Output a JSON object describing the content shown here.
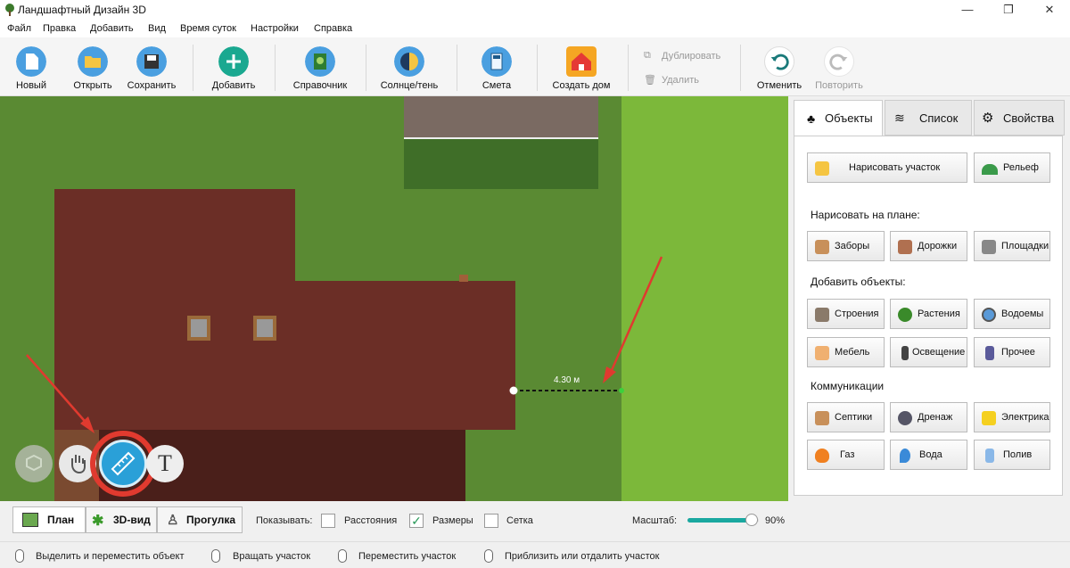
{
  "window": {
    "title": "Ландшафтный Дизайн 3D",
    "minimize": "—",
    "maximize": "❐",
    "close": "✕"
  },
  "menu": [
    "Файл",
    "Правка",
    "Добавить",
    "Вид",
    "Время суток",
    "Настройки",
    "Справка"
  ],
  "toolbar": {
    "new": "Новый",
    "open": "Открыть",
    "save": "Сохранить",
    "add": "Добавить",
    "reference": "Справочник",
    "sun": "Солнце/тень",
    "estimate": "Смета",
    "create_house": "Создать дом",
    "duplicate": "Дублировать",
    "delete": "Удалить",
    "undo": "Отменить",
    "redo": "Повторить"
  },
  "canvas": {
    "measure_label": "4.30 м",
    "text_tool": "T"
  },
  "panel": {
    "tabs": [
      "Объекты",
      "Список",
      "Свойства"
    ],
    "draw_plot": "Нарисовать участок",
    "relief": "Рельеф",
    "draw_on_plan": "Нарисовать на плане:",
    "draw_items": [
      "Заборы",
      "Дорожки",
      "Площадки"
    ],
    "add_objects": "Добавить объекты:",
    "objects": [
      "Строения",
      "Растения",
      "Водоемы",
      "Мебель",
      "Освещение",
      "Прочее"
    ],
    "communications": "Коммуникации",
    "comm_items": [
      "Септики",
      "Дренаж",
      "Электрика",
      "Газ",
      "Вода",
      "Полив"
    ]
  },
  "bottom": {
    "views": [
      "План",
      "3D-вид",
      "Прогулка"
    ],
    "show": "Показывать:",
    "distances": "Расстояния",
    "distances_checked": false,
    "sizes": "Размеры",
    "sizes_checked": true,
    "grid": "Сетка",
    "grid_checked": false,
    "scale_label": "Масштаб:",
    "scale_value": "90%",
    "scale_level": 0.9
  },
  "status": [
    "Выделить и переместить объект",
    "Вращать участок",
    "Переместить участок",
    "Приблизить или отдалить участок"
  ],
  "colors": {
    "grass": "#5a8a33",
    "lawn": "#7cb83a",
    "roof": "#6b2e26",
    "accent": "#e03a2f",
    "blue": "#2aa0d8"
  }
}
